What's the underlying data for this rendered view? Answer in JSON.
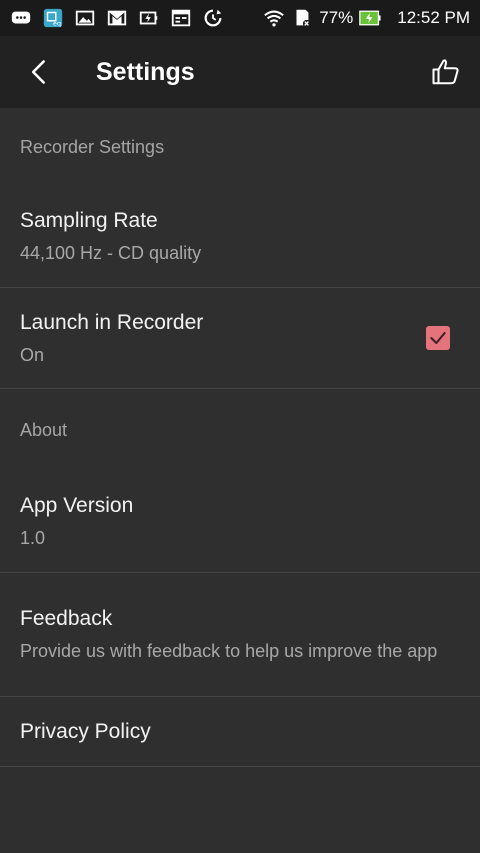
{
  "status_bar": {
    "battery_percent": "77%",
    "time": "12:52 PM",
    "icons": [
      "chat-icon",
      "app-badge-icon",
      "image-icon",
      "gmail-icon",
      "battery-saver-icon",
      "calendar-icon",
      "sync-icon",
      "wifi-icon",
      "sd-card-icon",
      "battery-charging-icon"
    ]
  },
  "app_bar": {
    "title": "Settings",
    "back_icon": "chevron-left-icon",
    "like_icon": "thumbs-up-icon"
  },
  "sections": {
    "recorder": {
      "header": "Recorder Settings",
      "sampling_rate": {
        "title": "Sampling Rate",
        "value": "44,100 Hz - CD quality"
      },
      "launch": {
        "title": "Launch in Recorder",
        "value": "On",
        "checked": true
      }
    },
    "about": {
      "header": "About",
      "version": {
        "title": "App Version",
        "value": "1.0"
      },
      "feedback": {
        "title": "Feedback",
        "value": "Provide us with feedback to help us improve the app"
      },
      "privacy": {
        "title": "Privacy Policy"
      }
    }
  },
  "colors": {
    "background": "#2f2f2f",
    "app_bar": "#222222",
    "status_bar": "#1a1a1a",
    "accent": "#e5737b",
    "divider": "#454545",
    "secondary_text": "#a8a8a8"
  }
}
